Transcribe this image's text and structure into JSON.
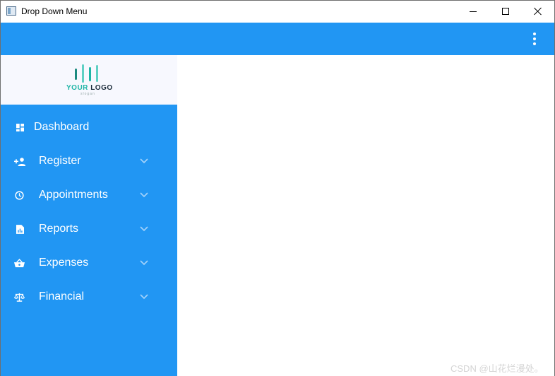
{
  "window": {
    "title": "Drop Down Menu"
  },
  "logo": {
    "brand_part1": "YOUR",
    "brand_part2": "LOGO",
    "slogan": "slogan"
  },
  "menu": {
    "items": [
      {
        "label": "Dashboard",
        "icon": "dashboard-icon",
        "has_dropdown": false
      },
      {
        "label": "Register",
        "icon": "person-add-icon",
        "has_dropdown": true
      },
      {
        "label": "Appointments",
        "icon": "clock-icon",
        "has_dropdown": true
      },
      {
        "label": "Reports",
        "icon": "report-icon",
        "has_dropdown": true
      },
      {
        "label": "Expenses",
        "icon": "basket-icon",
        "has_dropdown": true
      },
      {
        "label": "Financial",
        "icon": "scale-icon",
        "has_dropdown": true
      }
    ]
  },
  "watermark": "CSDN @山花烂漫处。",
  "colors": {
    "primary": "#2196f3",
    "logo_teal": "#1fb5a6",
    "logo_dark": "#1b2b3a"
  }
}
